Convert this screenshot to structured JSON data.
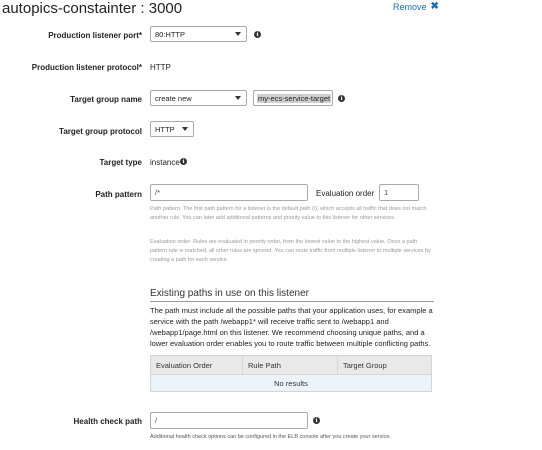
{
  "header": {
    "title": "autopics-constainter : 3000",
    "remove_label": "Remove",
    "remove_icon": "close-icon"
  },
  "form": {
    "production_listener_port": {
      "label": "Production listener port*",
      "value": "80:HTTP"
    },
    "production_listener_protocol": {
      "label": "Production listener protocol*",
      "value": "HTTP"
    },
    "target_group_name": {
      "label": "Target group name",
      "select_value": "create new",
      "input_value": "my-ecs-service-target"
    },
    "target_group_protocol": {
      "label": "Target group protocol",
      "value": "HTTP"
    },
    "target_type": {
      "label": "Target type",
      "value": "instance"
    },
    "path_pattern": {
      "label": "Path pattern",
      "value": "/*",
      "evaluation_order_label": "Evaluation order",
      "evaluation_order_value": "1",
      "help_path": "Path pattern: The first path pattern for a listener is the default path (/), which accepts all traffic that does not match another rule. You can later add additional patterns and priority value to this listener for other services.",
      "help_order": "Evaluation order: Rules are evaluated in priority order, from the lowest value to the highest value. Once a path pattern rule is matched, all other rules are ignored. You can route traffic from multiple listener to multiple services by creating a path for each service."
    },
    "health_check_path": {
      "label": "Health check path",
      "value": "/",
      "help": "Additional health check options can be configured in the ELB console after you create your service."
    }
  },
  "existing_paths": {
    "title": "Existing paths in use on this listener",
    "description": "The path must include all the possible paths that your application uses, for example a service with the path /webapp1* will receive traffic sent to /webapp1 and /webapp1/page.html on this listener. We recommend choosing unique paths, and a lower evaluation order enables you to route traffic between multiple conflicting paths.",
    "columns": [
      "Evaluation Order",
      "Rule Path",
      "Target Group"
    ],
    "empty_text": "No results"
  },
  "icons": {
    "info": "info-icon",
    "dropdown": "chevron-down-icon"
  },
  "colors": {
    "link": "#1a6fb5",
    "table_header": "#e9e9e9",
    "table_row": "#ecf4fb"
  }
}
